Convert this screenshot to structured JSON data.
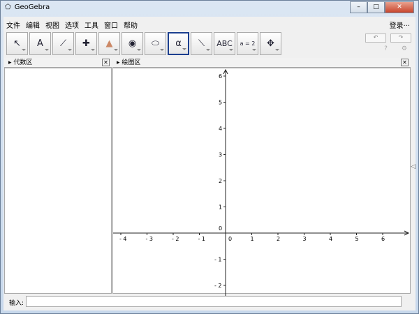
{
  "window": {
    "title": "GeoGebra",
    "min": "–",
    "max": "□",
    "close": "✕"
  },
  "menu": [
    "文件",
    "编辑",
    "视图",
    "选项",
    "工具",
    "窗口",
    "帮助"
  ],
  "login": "登录···",
  "toolbar": {
    "tools": [
      {
        "name": "move-tool-icon"
      },
      {
        "name": "point-tool-icon",
        "label": "A"
      },
      {
        "name": "line-tool-icon"
      },
      {
        "name": "perpendicular-tool-icon"
      },
      {
        "name": "polygon-tool-icon"
      },
      {
        "name": "circle-center-tool-icon"
      },
      {
        "name": "conic-tool-icon"
      },
      {
        "name": "angle-tool-icon",
        "label": "α"
      },
      {
        "name": "reflect-tool-icon"
      },
      {
        "name": "text-tool-icon",
        "label": "ABC"
      },
      {
        "name": "slider-tool-icon",
        "label": "a = 2"
      },
      {
        "name": "move-view-tool-icon"
      }
    ],
    "selected": 7,
    "undo": "↶",
    "redo": "↷",
    "help": "?",
    "settings": "⚙"
  },
  "algebra": {
    "title": "代数区"
  },
  "graphics": {
    "title": "绘图区"
  },
  "chart_data": {
    "type": "axes",
    "x_ticks": [
      -4,
      -3,
      -2,
      -1,
      0,
      1,
      2,
      3,
      4,
      5,
      6
    ],
    "y_ticks": [
      -2,
      -1,
      0,
      1,
      2,
      3,
      4,
      5,
      6
    ],
    "xlim": [
      -4.3,
      7.0
    ],
    "ylim": [
      -2.4,
      6.3
    ],
    "grid": false
  },
  "input": {
    "label": "输入:"
  }
}
